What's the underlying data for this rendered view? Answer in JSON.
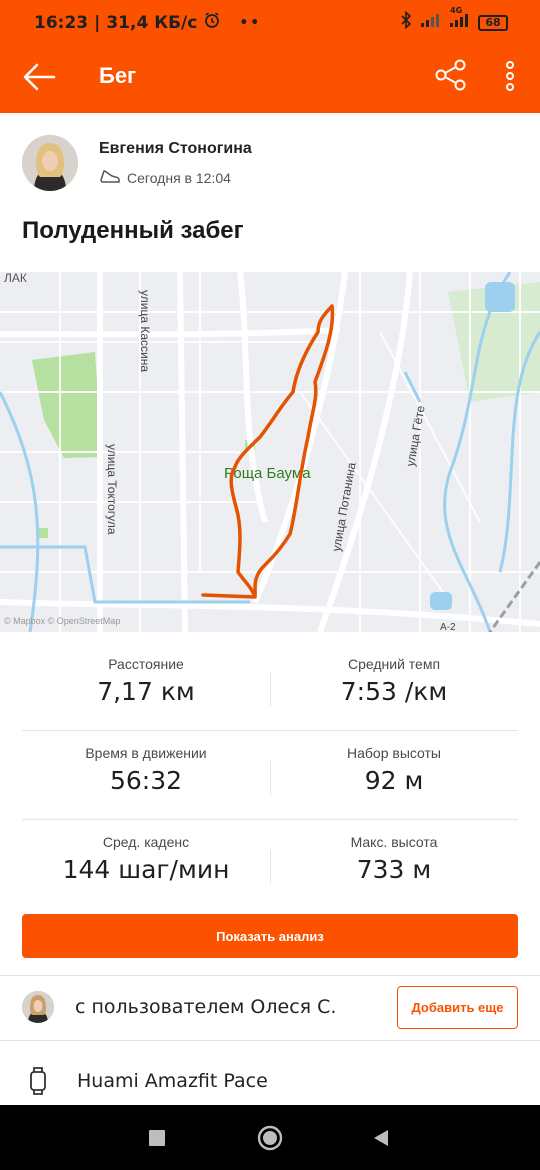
{
  "status_bar": {
    "time": "16:23",
    "speed": "31,4 КБ/с",
    "dots": "••",
    "network": "4G",
    "battery": "68"
  },
  "app_bar": {
    "title": "Бег"
  },
  "athlete": {
    "name": "Евгения Стоногина",
    "date": "Сегодня в 12:04"
  },
  "activity": {
    "title": "Полуденный забег"
  },
  "map": {
    "labels": {
      "top_left": "ЛАК",
      "street1": "улица Кассина",
      "street2": "улица Токтогула",
      "park": "Роща Баума",
      "street3": "улица Потанина",
      "street4": "улица Гёте",
      "highway": "А-2",
      "copyright": "© Mapbox © OpenStreetMap"
    },
    "colors": {
      "route": "#e35300",
      "park": "#b5e0a0",
      "water": "#9cd0ee",
      "road": "#ffffff"
    }
  },
  "stats": [
    {
      "label": "Расстояние",
      "value": "7,17 км"
    },
    {
      "label": "Средний темп",
      "value": "7:53 /км"
    },
    {
      "label": "Время в движении",
      "value": "56:32"
    },
    {
      "label": "Набор высоты",
      "value": "92 м"
    },
    {
      "label": "Сред. каденс",
      "value": "144 шаг/мин"
    },
    {
      "label": "Макс. высота",
      "value": "733 м"
    }
  ],
  "actions": {
    "analysis_button": "Показать анализ",
    "with_text": "с пользователем Олеся С.",
    "add_more_button": "Добавить еще"
  },
  "device": {
    "name": "Huami Amazfit Pace"
  },
  "colors": {
    "accent": "#fc5200"
  }
}
